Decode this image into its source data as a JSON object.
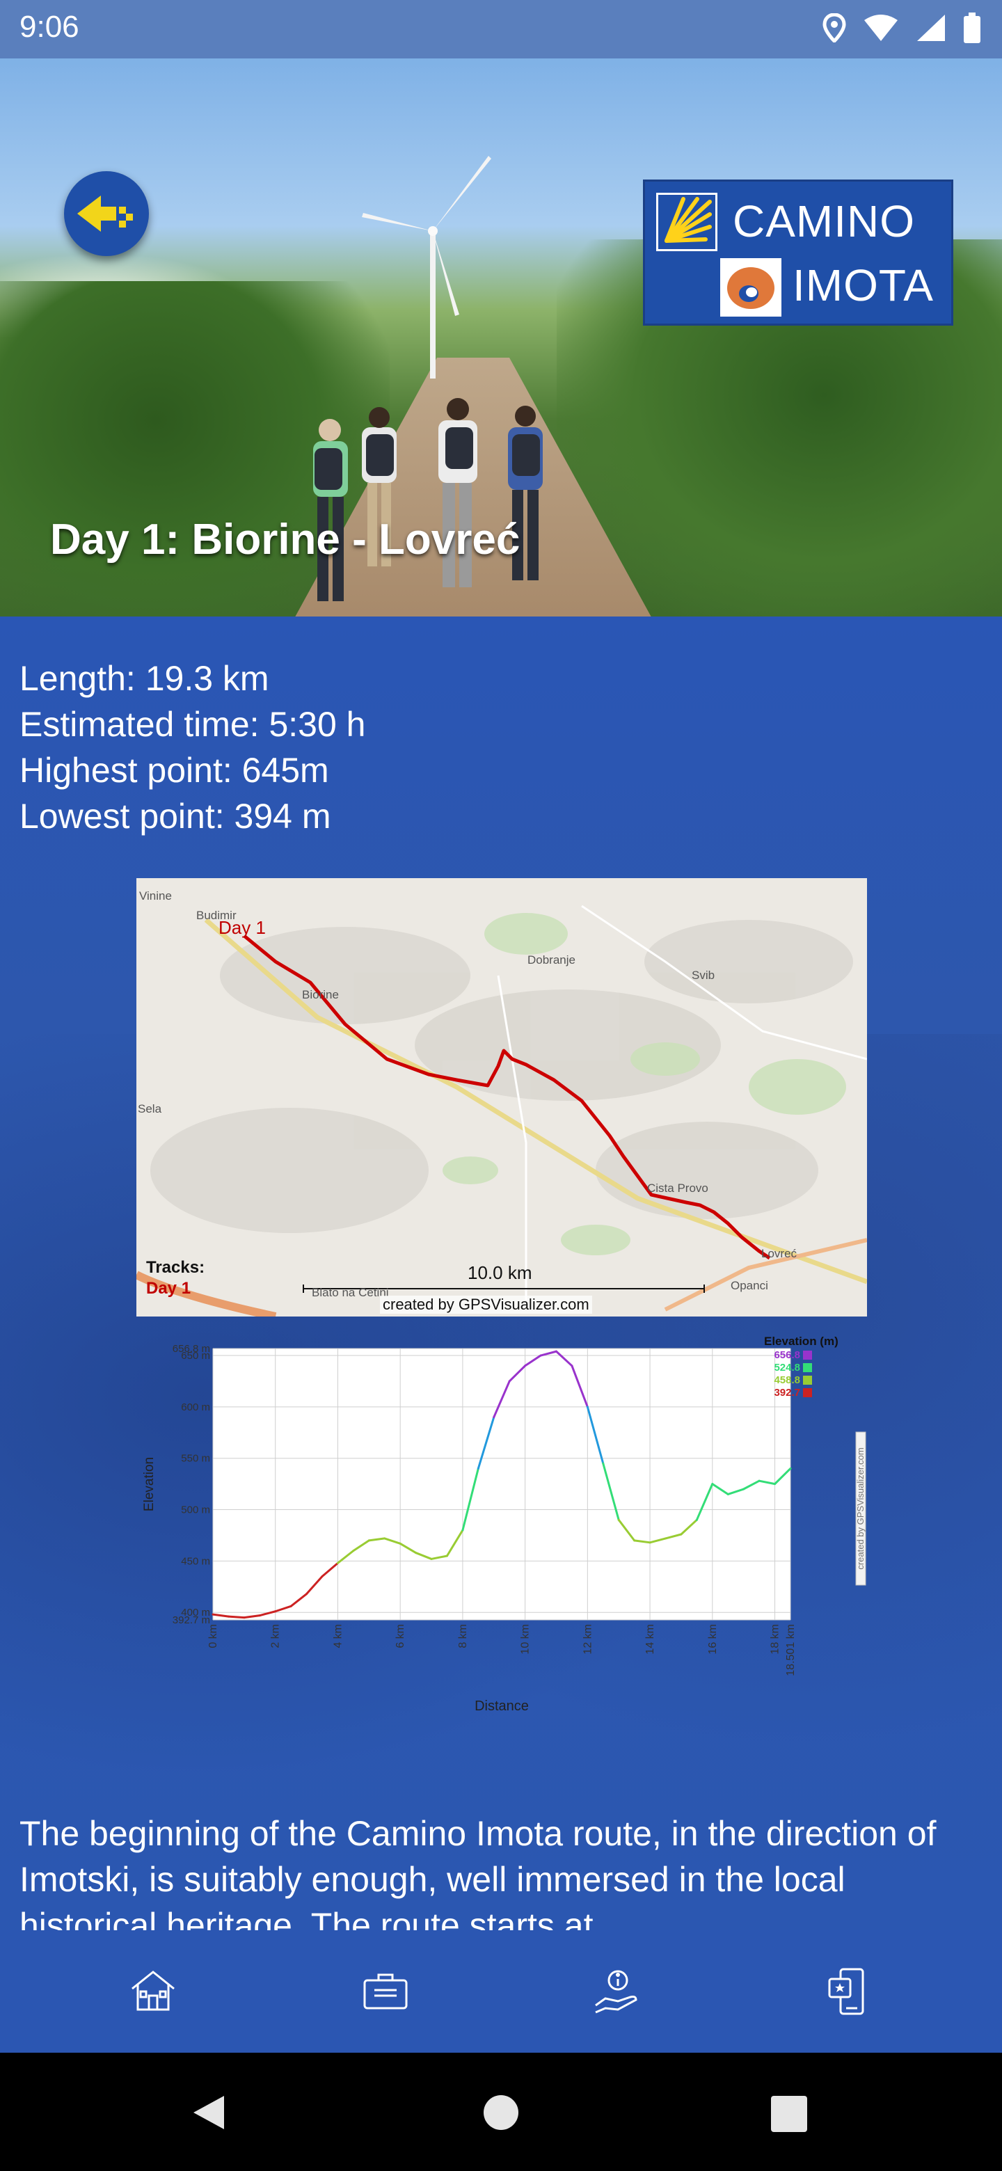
{
  "status_bar": {
    "time": "9:06",
    "icons": [
      "location-icon",
      "wifi-icon",
      "signal-icon",
      "battery-icon"
    ]
  },
  "header": {
    "title": "Day 1: Biorine - Lovreć",
    "logo": {
      "line1": "CAMINO",
      "line2": "IMOTA"
    },
    "back_icon": "arrow-left-icon"
  },
  "stats": {
    "length": "Length: 19.3 km",
    "time": "Estimated time: 5:30 h",
    "highest": "Highest point: 645m",
    "lowest": "Lowest point: 394 m"
  },
  "map": {
    "places": [
      "Vinine",
      "Budimir",
      "Biorine",
      "Dobranje",
      "Svib",
      "Sela",
      "Cista Provo",
      "Lovreć",
      "Opanci",
      "Blato na Cetini"
    ],
    "track_label": "Day 1",
    "legend_title": "Tracks:",
    "legend_item": "Day 1",
    "scale": "10.0 km",
    "credit": "created by GPSVisualizer.com"
  },
  "chart_data": {
    "type": "line",
    "title": "",
    "xlabel": "Distance",
    "ylabel": "Elevation",
    "legend_title": "Elevation (m)",
    "legend_values": [
      "656.8",
      "524.8",
      "458.8",
      "392.7"
    ],
    "side_credit": "created by GPSVisualizer.com",
    "x_ticks": [
      "0 km",
      "2 km",
      "4 km",
      "6 km",
      "8 km",
      "10 km",
      "12 km",
      "14 km",
      "16 km",
      "18 km",
      "18.501 km"
    ],
    "y_ticks": [
      "392.7 m",
      "400 m",
      "450 m",
      "500 m",
      "550 m",
      "600 m",
      "650 m",
      "656.8 m"
    ],
    "xlim": [
      0,
      18.501
    ],
    "ylim": [
      392.7,
      656.8
    ],
    "grid": true,
    "colors": {
      "low": "#cc2222",
      "mid_low": "#99cc33",
      "mid": "#33dd77",
      "mid_high": "#2299dd",
      "high": "#9933cc"
    },
    "x": [
      0,
      0.5,
      1.0,
      1.5,
      2.0,
      2.5,
      3.0,
      3.5,
      4.0,
      4.5,
      5.0,
      5.5,
      6.0,
      6.5,
      7.0,
      7.5,
      8.0,
      8.5,
      9.0,
      9.5,
      10.0,
      10.5,
      11.0,
      11.5,
      12.0,
      12.5,
      13.0,
      13.5,
      14.0,
      14.5,
      15.0,
      15.5,
      16.0,
      16.5,
      17.0,
      17.5,
      18.0,
      18.501
    ],
    "y": [
      398,
      396,
      395,
      397,
      401,
      406,
      418,
      435,
      448,
      460,
      470,
      472,
      467,
      458,
      452,
      455,
      480,
      540,
      590,
      625,
      640,
      650,
      654,
      640,
      600,
      545,
      490,
      470,
      468,
      472,
      476,
      490,
      525,
      515,
      520,
      528,
      525,
      540
    ]
  },
  "description": {
    "text": "The beginning of the Camino Imota route, in the direction of Imotski, is suitably enough, well immersed in the local historical heritage. The route starts at"
  },
  "bottom_nav": {
    "items": [
      {
        "icon": "home-icon"
      },
      {
        "icon": "briefcase-icon"
      },
      {
        "icon": "info-hand-icon"
      },
      {
        "icon": "phone-star-icon"
      }
    ]
  },
  "system_nav": {
    "icons": [
      "back-triangle-icon",
      "home-circle-icon",
      "recents-square-icon"
    ]
  }
}
